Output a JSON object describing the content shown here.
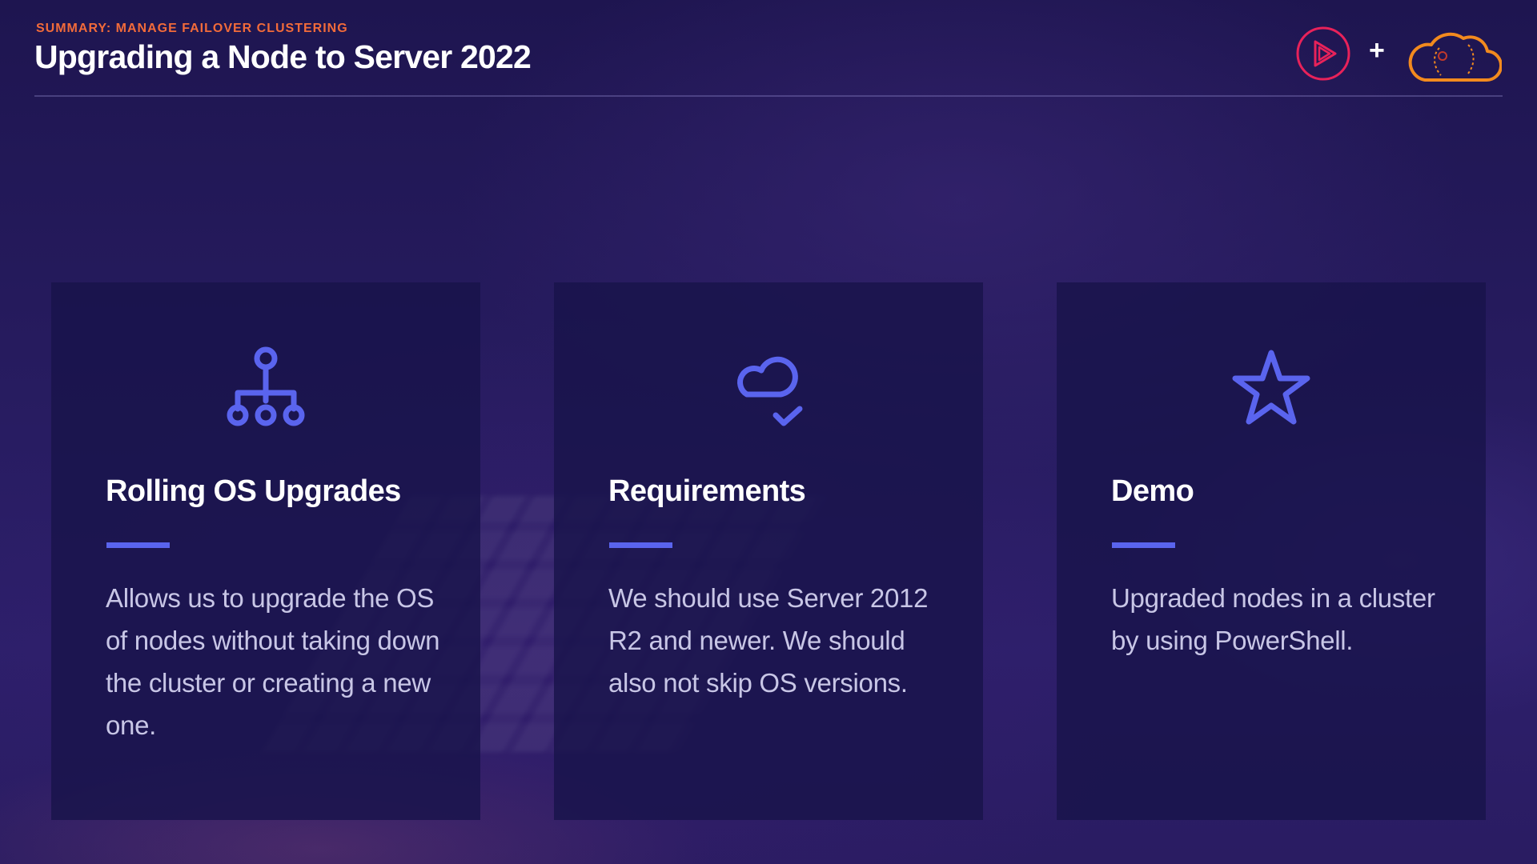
{
  "header": {
    "kicker": "SUMMARY: MANAGE FAILOVER CLUSTERING",
    "title": "Upgrading a Node to Server 2022",
    "plus": "+"
  },
  "logos": {
    "left": "pluralsight-play-icon",
    "right": "cloud-logo-icon"
  },
  "colors": {
    "accent": "#5a64ee",
    "kicker": "#f26b3a",
    "logo_play": "#e8225a",
    "logo_cloud": "#f28a1e"
  },
  "cards": [
    {
      "icon": "hierarchy-icon",
      "title": "Rolling OS Upgrades",
      "body": "Allows us to upgrade the OS of nodes without taking down the cluster or creating a new one."
    },
    {
      "icon": "cloud-check-icon",
      "title": "Requirements",
      "body": "We should use Server 2012 R2 and newer. We should also not skip OS versions."
    },
    {
      "icon": "star-icon",
      "title": "Demo",
      "body": "Upgraded nodes in a cluster by using PowerShell."
    }
  ]
}
